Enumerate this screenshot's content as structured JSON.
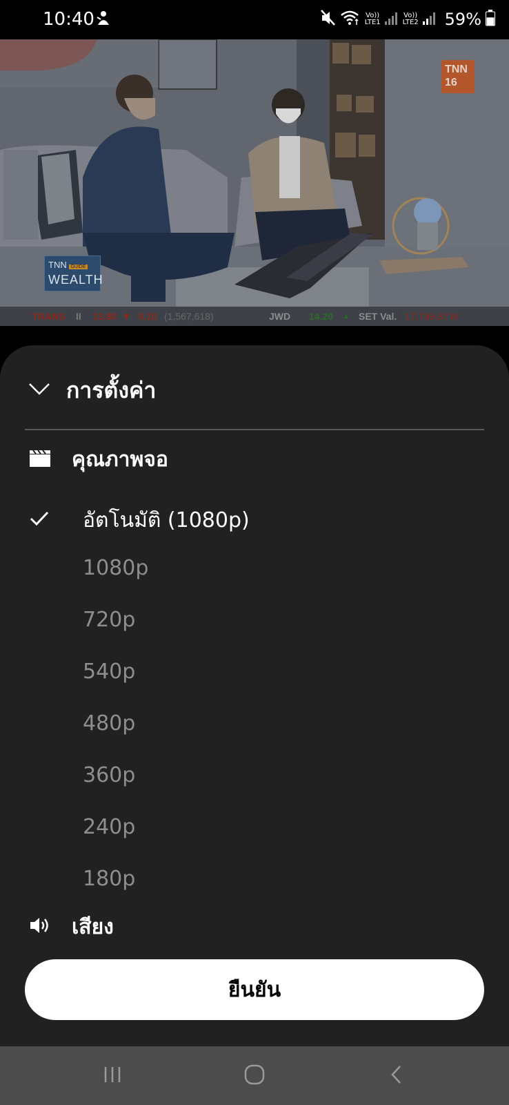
{
  "status_bar": {
    "time": "10:40",
    "sim1_label": "LTE1",
    "sim2_label": "LTE2",
    "volte_label": "Vo))",
    "battery_percent": "59%",
    "battery_level": 0.59
  },
  "video": {
    "channel_badge_line1": "TNN",
    "channel_badge_line2": "16",
    "brand_logo_line1": "TNN",
    "brand_logo_guide": "GUIDE",
    "brand_logo_line2": "WEALTH",
    "ticker": {
      "symbol1": "TRANS",
      "symbol1_price": "13.80",
      "symbol1_change": "0.10",
      "symbol1_volume": "(1,567,618)",
      "symbol2": "JWD",
      "symbol2_price": "14.20",
      "set_label": "SET Val.",
      "set_value": "17,799.87 M"
    }
  },
  "settings": {
    "title": "การตั้งค่า",
    "quality_section": {
      "label": "คุณภาพจอ",
      "options": [
        {
          "label": "อัตโนมัติ (1080p)",
          "selected": true
        },
        {
          "label": "1080p",
          "selected": false
        },
        {
          "label": "720p",
          "selected": false
        },
        {
          "label": "540p",
          "selected": false
        },
        {
          "label": "480p",
          "selected": false
        },
        {
          "label": "360p",
          "selected": false
        },
        {
          "label": "240p",
          "selected": false
        },
        {
          "label": "180p",
          "selected": false
        }
      ]
    },
    "audio_section": {
      "label": "เสียง"
    },
    "confirm_label": "ยืนยัน"
  },
  "icons": {
    "collapse": "chevron-down-icon",
    "quality": "clapperboard-icon",
    "selected": "checkmark-icon",
    "audio": "speaker-icon",
    "nav_recents": "recents-icon",
    "nav_home": "home-icon",
    "nav_back": "back-icon"
  },
  "colors": {
    "sheet_background": "#212121",
    "inactive_option": "#8e8e8e",
    "confirm_button": "#ffffff",
    "nav_bar": "#4c4c4c"
  }
}
